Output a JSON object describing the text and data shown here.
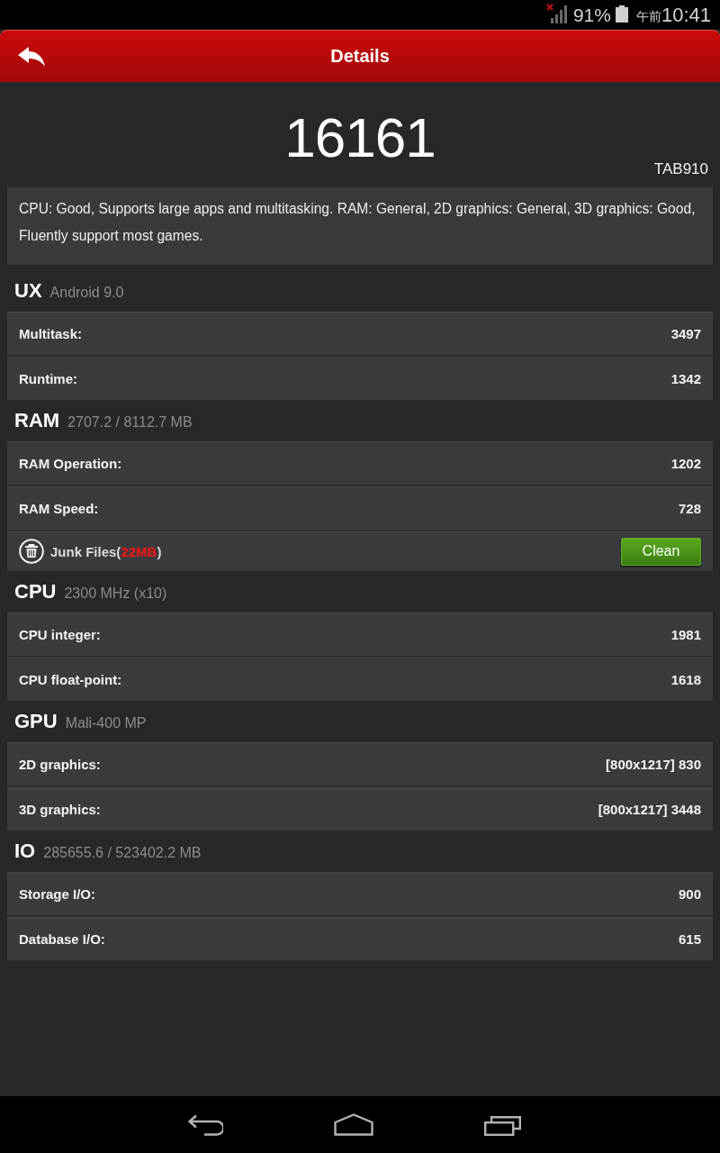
{
  "status_bar": {
    "battery": "91%",
    "time_period": "午前",
    "time": "10:41"
  },
  "header": {
    "title": "Details"
  },
  "result": {
    "score": "16161",
    "device": "TAB910",
    "summary": "CPU: Good, Supports large apps and multitasking. RAM: General, 2D graphics: General, 3D graphics: Good, Fluently support most games."
  },
  "sections": [
    {
      "title": "UX",
      "subtitle": "Android 9.0",
      "rows": [
        {
          "kind": "score",
          "label": "Multitask:",
          "value": "3497"
        },
        {
          "kind": "score",
          "label": "Runtime:",
          "value": "1342"
        }
      ]
    },
    {
      "title": "RAM",
      "subtitle": "2707.2 / 8112.7 MB",
      "rows": [
        {
          "kind": "score",
          "label": "RAM Operation:",
          "value": "1202"
        },
        {
          "kind": "score",
          "label": "RAM Speed:",
          "value": "728"
        },
        {
          "kind": "junk",
          "label": "Junk Files(",
          "size": "22MB",
          "label_end": ")",
          "button": "Clean"
        }
      ]
    },
    {
      "title": "CPU",
      "subtitle": "2300 MHz (x10)",
      "rows": [
        {
          "kind": "score",
          "label": "CPU integer:",
          "value": "1981"
        },
        {
          "kind": "score",
          "label": "CPU float-point:",
          "value": "1618"
        }
      ]
    },
    {
      "title": "GPU",
      "subtitle": "Mali-400 MP",
      "rows": [
        {
          "kind": "score",
          "label": "2D graphics:",
          "value": "[800x1217] 830"
        },
        {
          "kind": "score",
          "label": "3D graphics:",
          "value": "[800x1217] 3448"
        }
      ]
    },
    {
      "title": "IO",
      "subtitle": "285655.6 / 523402.2 MB",
      "rows": [
        {
          "kind": "score",
          "label": "Storage I/O:",
          "value": "900"
        },
        {
          "kind": "score",
          "label": "Database I/O:",
          "value": "615"
        }
      ]
    }
  ]
}
